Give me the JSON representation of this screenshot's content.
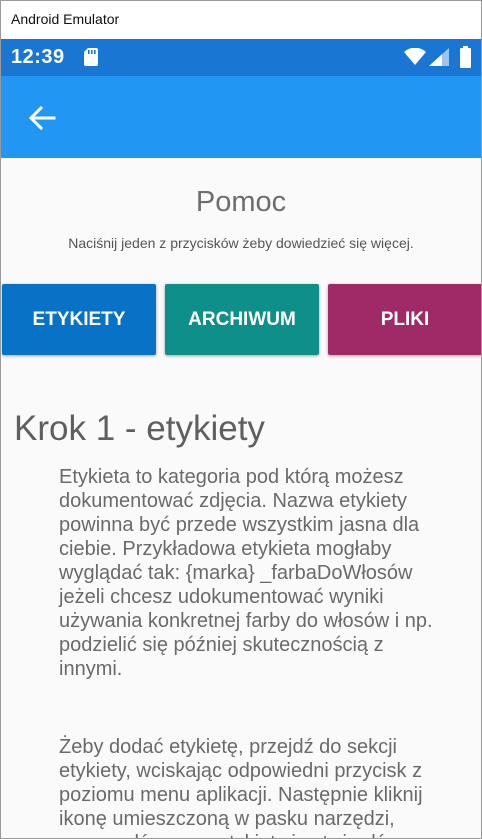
{
  "window": {
    "title": "Android Emulator"
  },
  "status_bar": {
    "time": "12:39",
    "icons": [
      "sd-card-icon",
      "wifi-icon",
      "signal-icon",
      "battery-icon"
    ],
    "color": "#1976d2"
  },
  "app_bar": {
    "back_icon": "arrow-left-icon",
    "color": "#2196f3"
  },
  "help": {
    "title": "Pomoc",
    "subtitle": "Naciśnij jeden z przycisków żeby dowiedzieć się więcej.",
    "buttons": [
      {
        "label": "ETYKIETY",
        "color": "#0872c7"
      },
      {
        "label": "ARCHIWUM",
        "color": "#0e8f8a"
      },
      {
        "label": "PLIKI",
        "color": "#a02a68"
      }
    ],
    "section_heading": "Krok 1 - etykiety",
    "paragraphs": [
      "Etykieta to kategoria pod którą możesz dokumentować zdjęcia. Nazwa etykiety powinna być przede wszystkim jasna dla ciebie. Przykładowa etykieta mogłaby wyglądać tak: {marka} _farbaDoWłosów jeżeli chcesz udokumentować wyniki używania konkretnej farby do włosów i np. podzielić się później skutecznością z innymi.",
      "Żeby dodać etykietę, przejdź do sekcji etykiety, wciskając odpowiedni przycisk z poziomu menu aplikacji. Następnie kliknij ikonę umieszczoną w pasku narzędzi, wprowadź nazwę etykiety i zatwierdź."
    ]
  }
}
